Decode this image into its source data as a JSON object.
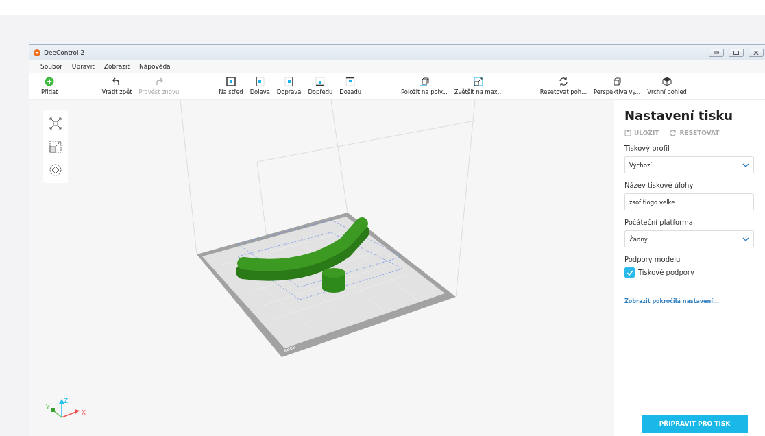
{
  "window": {
    "title": "DeeControl 2"
  },
  "menu": [
    "Soubor",
    "Upravit",
    "Zobrazit",
    "Nápověda"
  ],
  "toolbar": {
    "groups": [
      [
        {
          "label": "Přidat",
          "disabled": false
        }
      ],
      [
        {
          "label": "Vrátit zpět",
          "disabled": false
        },
        {
          "label": "Provést znovu",
          "disabled": true
        }
      ],
      [
        {
          "label": "Na střed",
          "disabled": false
        },
        {
          "label": "Doleva",
          "disabled": false
        },
        {
          "label": "Doprava",
          "disabled": false
        },
        {
          "label": "Dopředu",
          "disabled": false
        },
        {
          "label": "Dozadu",
          "disabled": false
        }
      ],
      [
        {
          "label": "Položit na poly...",
          "disabled": false
        },
        {
          "label": "Zvětšit na max...",
          "disabled": false
        }
      ],
      [
        {
          "label": "Resetovat poh...",
          "disabled": false
        },
        {
          "label": "Perspektiva vy...",
          "disabled": false
        },
        {
          "label": "Vrchní pohled",
          "disabled": false
        }
      ]
    ]
  },
  "viewport": {
    "bed_label": "eBee",
    "axes": [
      "X",
      "Y",
      "Z"
    ]
  },
  "panel": {
    "title": "Nastavení tisku",
    "actions": [
      {
        "label": "ULOŽIT",
        "disabled": true
      },
      {
        "label": "RESETOVAT",
        "disabled": true
      }
    ],
    "fields": [
      {
        "kind": "select",
        "label": "Tiskový profil",
        "value": "Výchozí"
      },
      {
        "kind": "text",
        "label": "Název tiskové úlohy",
        "value": "zsof tlogo velke"
      },
      {
        "kind": "select",
        "label": "Počáteční platforma",
        "value": "Žádný"
      }
    ],
    "supports": {
      "label": "Podpory modelu",
      "option": "Tiskové podpory",
      "checked": true
    },
    "advanced_link": "Zobrazit pokročilá nastavení...",
    "print_button": "PŘIPRAVIT PRO TISK"
  }
}
